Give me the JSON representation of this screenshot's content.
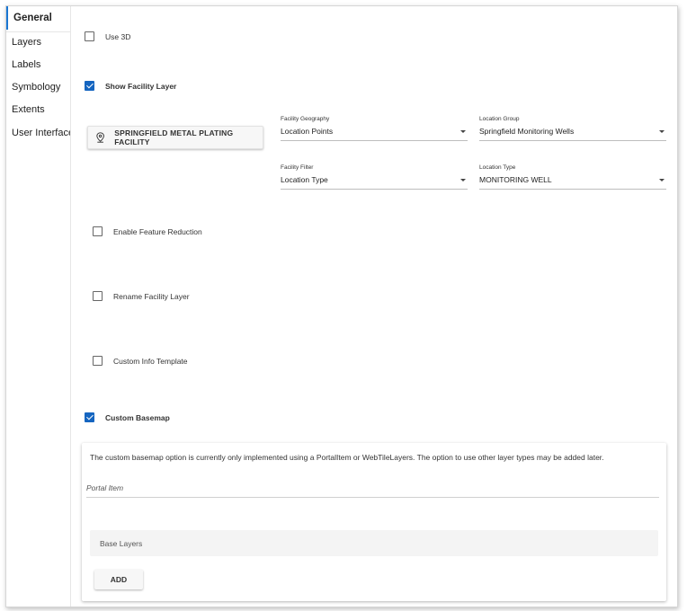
{
  "sidebar": {
    "items": [
      {
        "label": "General",
        "active": true
      },
      {
        "label": "Layers"
      },
      {
        "label": "Labels"
      },
      {
        "label": "Symbology"
      },
      {
        "label": "Extents"
      },
      {
        "label": "User Interface"
      }
    ]
  },
  "general": {
    "use_3d": {
      "label": "Use 3D",
      "checked": false
    },
    "show_facility_layer": {
      "label": "Show Facility Layer",
      "checked": true
    },
    "facility_button_label": "SPRINGFIELD METAL PLATING FACILITY",
    "facility_geography": {
      "label": "Facility Geography",
      "value": "Location Points"
    },
    "location_group": {
      "label": "Location Group",
      "value": "Springfield Monitoring Wells"
    },
    "facility_filter": {
      "label": "Facility Filter",
      "value": "Location Type"
    },
    "location_type": {
      "label": "Location Type",
      "value": "MONITORING WELL"
    },
    "enable_feature_reduction": {
      "label": "Enable Feature Reduction",
      "checked": false
    },
    "rename_facility_layer": {
      "label": "Rename Facility Layer",
      "checked": false
    },
    "custom_info_template": {
      "label": "Custom Info Template",
      "checked": false
    },
    "custom_basemap": {
      "label": "Custom Basemap",
      "checked": true
    }
  },
  "basemap": {
    "description": "The custom basemap option is currently only implemented using a PortalItem or WebTileLayers. The option to use other layer types may be added later.",
    "portal_item_label": "Portal Item",
    "base_layers_label": "Base Layers",
    "add_label": "ADD"
  },
  "colors": {
    "accent": "#1565c0",
    "active_tab": "#1976d2"
  }
}
